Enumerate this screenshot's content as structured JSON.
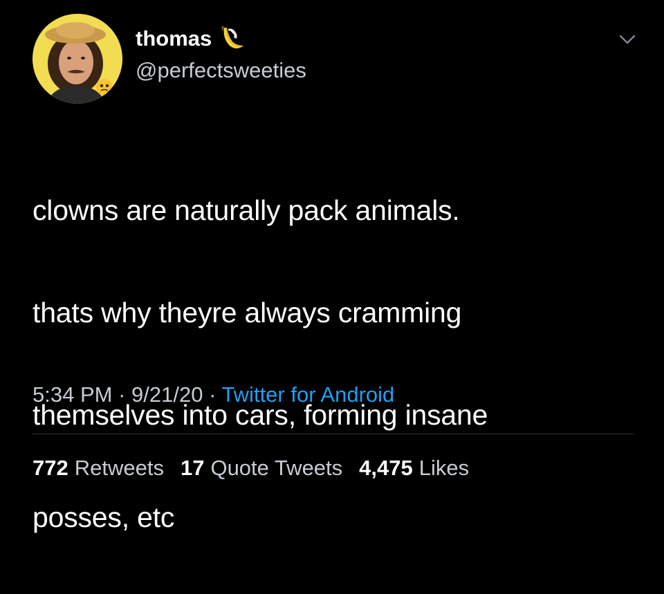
{
  "tweet": {
    "author": {
      "display_name": "thomas",
      "handle": "@perfectsweeties",
      "badge_icon": "banana-emoji-icon",
      "avatar_icon": "profile-photo-avatar",
      "avatar_background": "#f2dc52"
    },
    "menu_icon": "chevron-down-icon",
    "text_lines": [
      "clowns are naturally pack animals.",
      "thats why theyre always cramming",
      "themselves into cars, forming insane",
      "posses, etc"
    ],
    "meta": {
      "time": "5:34 PM",
      "separator": " · ",
      "date": "9/21/20",
      "source": "Twitter for Android"
    },
    "stats": [
      {
        "count": "772",
        "label": "Retweets"
      },
      {
        "count": "17",
        "label": "Quote Tweets"
      },
      {
        "count": "4,475",
        "label": "Likes"
      }
    ]
  },
  "colors": {
    "background": "#000000",
    "text_primary": "#ffffff",
    "text_secondary": "#c6ccd2",
    "link": "#1da1f2",
    "divider": "#2f3336"
  }
}
